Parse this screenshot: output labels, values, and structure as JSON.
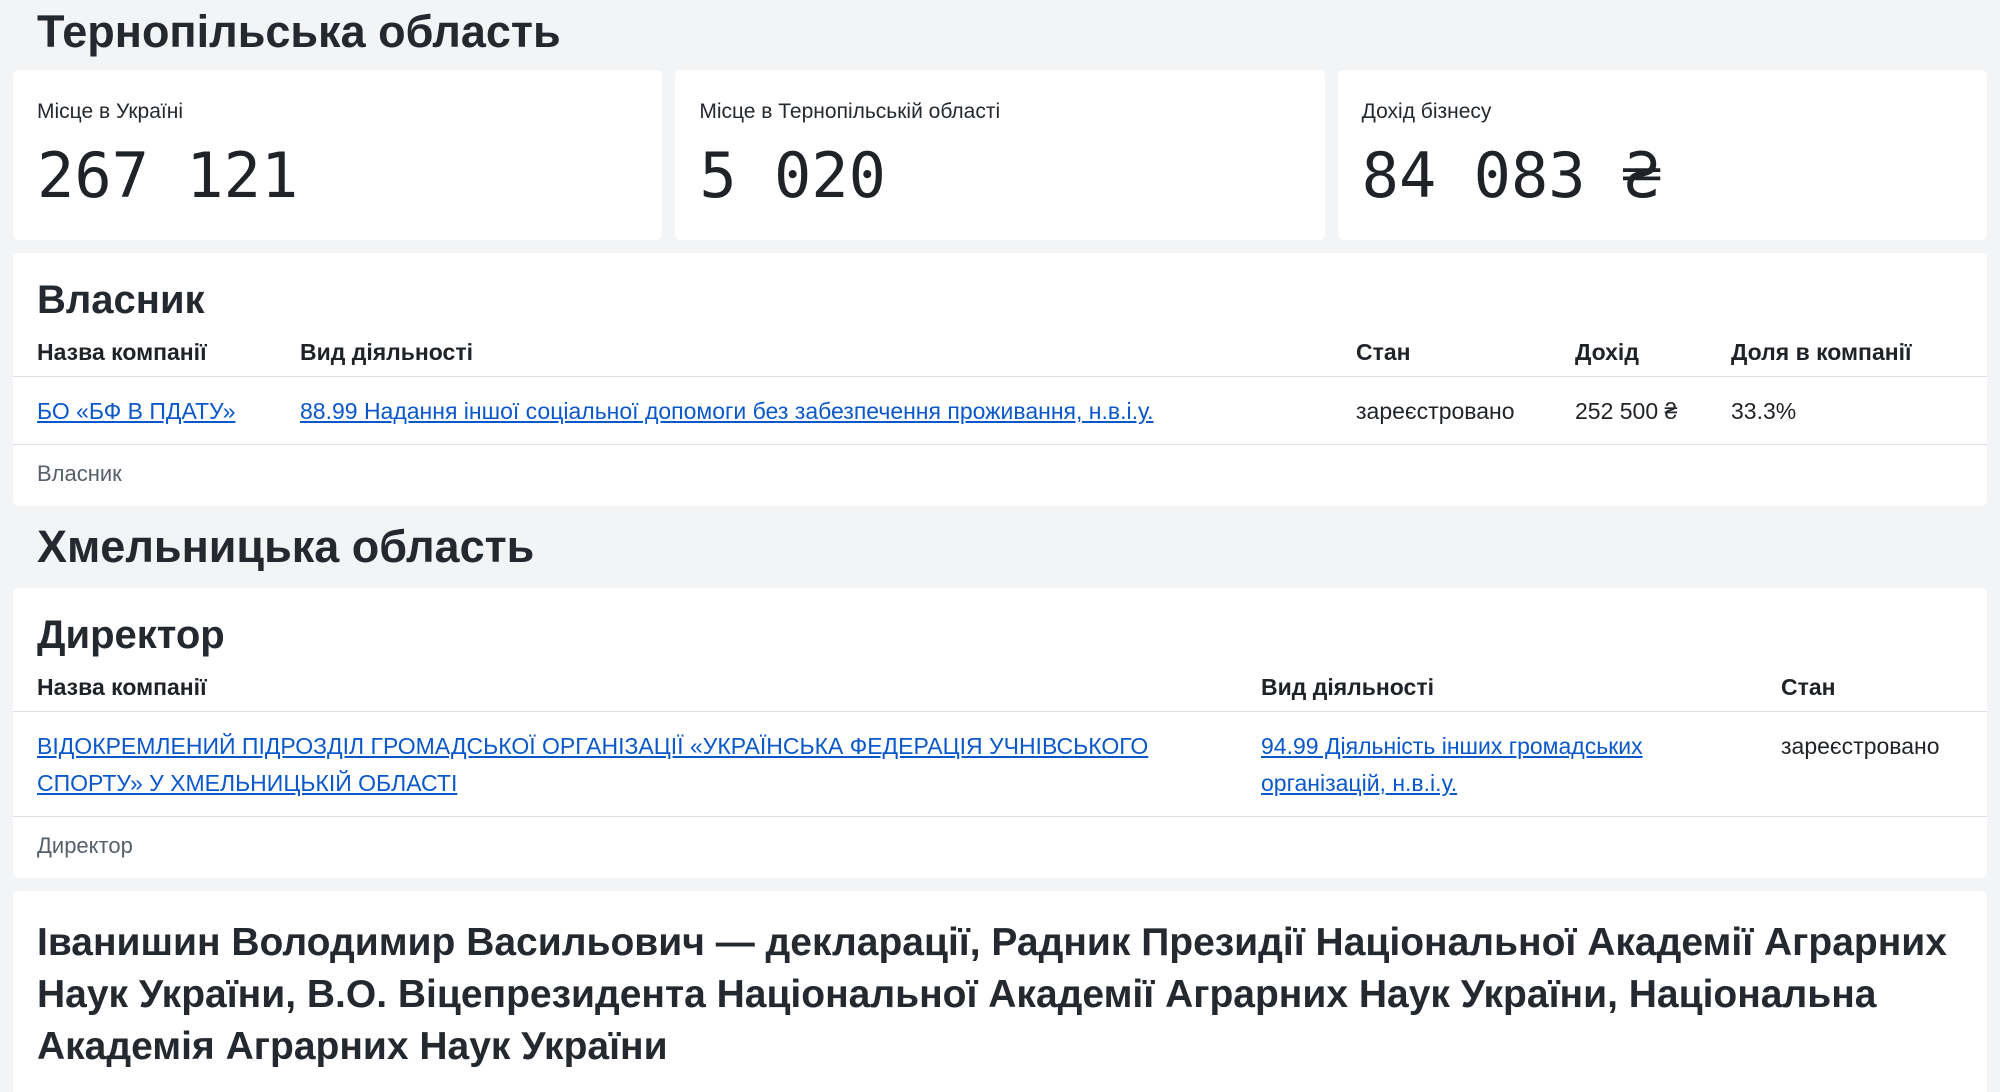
{
  "ternopil": {
    "region_title": "Тернопільська область",
    "stats": [
      {
        "label": "Місце в Україні",
        "value": "267 121"
      },
      {
        "label": "Місце в Тернопільській області",
        "value": "5 020"
      },
      {
        "label": "Дохід бізнесу",
        "value": "84 083 ₴"
      }
    ],
    "owner_section": {
      "title": "Власник",
      "columns": [
        "Назва компанії",
        "Вид діяльності",
        "Стан",
        "Дохід",
        "Доля в компанії"
      ],
      "rows": [
        {
          "company": "БО «БФ В ПДАТУ»",
          "activity": "88.99 Надання іншої соціальної допомоги без забезпечення проживання, н.в.і.у.",
          "status": "зареєстровано",
          "income": "252 500 ₴",
          "share": "33.3%"
        }
      ],
      "caption": "Власник"
    }
  },
  "khmelnytskyi": {
    "region_title": "Хмельницька область",
    "director_section": {
      "title": "Директор",
      "columns": [
        "Назва компанії",
        "Вид діяльності",
        "Стан"
      ],
      "rows": [
        {
          "company": "ВІДОКРЕМЛЕНИЙ ПІДРОЗДІЛ ГРОМАДСЬКОЇ ОРГАНІЗАЦІЇ «УКРАЇНСЬКА ФЕДЕРАЦІЯ УЧНІВСЬКОГО СПОРТУ» У ХМЕЛЬНИЦЬКІЙ ОБЛАСТІ",
          "activity": "94.99 Діяльність інших громадських організацій, н.в.і.у.",
          "status": "зареєстровано"
        }
      ],
      "caption": "Директор"
    }
  },
  "declaration": {
    "title": "Іванишин Володимир Васильович — декларації, Радник Президії Національної Академії Аграрних Наук України, В.О. Віцепрезидента Національної Академії Аграрних Наук України, Національна Академія Аграрних Наук України"
  }
}
